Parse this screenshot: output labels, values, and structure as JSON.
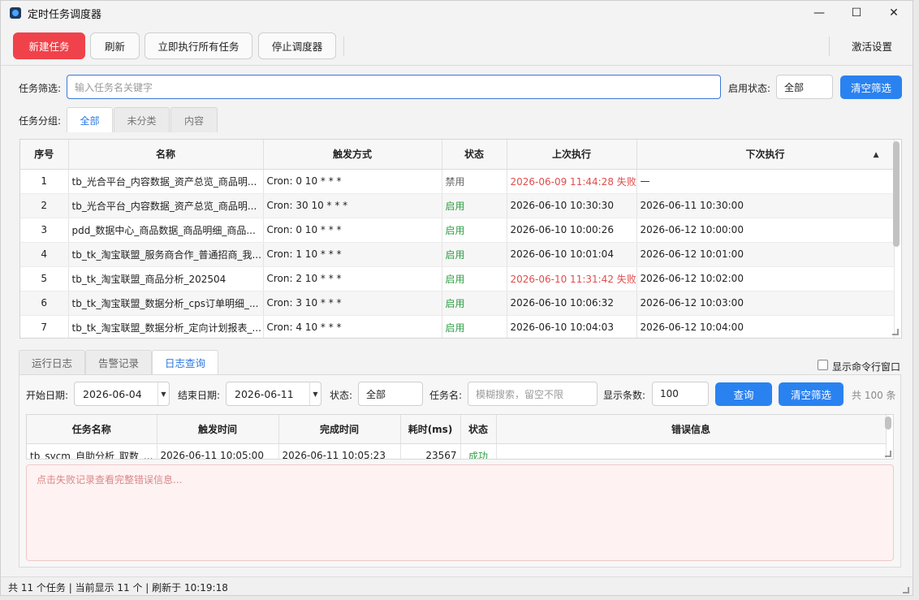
{
  "window": {
    "title": "定时任务调度器"
  },
  "win_controls": {
    "minimize": "—",
    "maximize": "☐",
    "close": "✕"
  },
  "toolbar": {
    "new_task": "新建任务",
    "refresh": "刷新",
    "run_all": "立即执行所有任务",
    "stop_scheduler": "停止调度器",
    "activate": "激活设置"
  },
  "filter": {
    "label": "任务筛选:",
    "placeholder": "输入任务名关键字",
    "status_label": "启用状态:",
    "status_value": "全部",
    "clear_button": "清空筛选"
  },
  "groups": {
    "label": "任务分组:",
    "tabs": [
      "全部",
      "未分类",
      "内容"
    ],
    "active": "全部"
  },
  "task_table": {
    "columns": [
      "序号",
      "名称",
      "触发方式",
      "状态",
      "上次执行",
      "下次执行"
    ],
    "sort_indicator": "▲",
    "rows": [
      {
        "no": "1",
        "name": "tb_光合平台_内容数据_资产总览_商品明...",
        "trigger": "Cron: 0 10 * * *",
        "status": "禁用",
        "last": "2026-06-09 11:44:28 失败",
        "next": "—"
      },
      {
        "no": "2",
        "name": "tb_光合平台_内容数据_资产总览_商品明...",
        "trigger": "Cron: 30 10 * * *",
        "status": "启用",
        "last": "2026-06-10 10:30:30",
        "next": "2026-06-11 10:30:00"
      },
      {
        "no": "3",
        "name": "pdd_数据中心_商品数据_商品明细_商品...",
        "trigger": "Cron: 0 10 * * *",
        "status": "启用",
        "last": "2026-06-10 10:00:26",
        "next": "2026-06-12 10:00:00"
      },
      {
        "no": "4",
        "name": "tb_tk_淘宝联盟_服务商合作_普通招商_我...",
        "trigger": "Cron: 1 10 * * *",
        "status": "启用",
        "last": "2026-06-10 10:01:04",
        "next": "2026-06-12 10:01:00"
      },
      {
        "no": "5",
        "name": "tb_tk_淘宝联盟_商品分析_202504",
        "trigger": "Cron: 2 10 * * *",
        "status": "启用",
        "last": "2026-06-10 11:31:42 失败",
        "next": "2026-06-12 10:02:00"
      },
      {
        "no": "6",
        "name": "tb_tk_淘宝联盟_数据分析_cps订单明细_...",
        "trigger": "Cron: 3 10 * * *",
        "status": "启用",
        "last": "2026-06-10 10:06:32",
        "next": "2026-06-12 10:03:00"
      },
      {
        "no": "7",
        "name": "tb_tk_淘宝联盟_数据分析_定向计划报表_...",
        "trigger": "Cron: 4 10 * * *",
        "status": "启用",
        "last": "2026-06-10 10:04:03",
        "next": "2026-06-12 10:04:00"
      }
    ]
  },
  "bottom_tabs": [
    "运行日志",
    "告警记录",
    "日志查询"
  ],
  "bottom_active": "日志查询",
  "show_cmd": {
    "label": "显示命令行窗口",
    "checked": false
  },
  "log_query": {
    "start_label": "开始日期:",
    "start_value": "2026-06-04",
    "end_label": "结束日期:",
    "end_value": "2026-06-11",
    "status_label": "状态:",
    "status_value": "全部",
    "task_label": "任务名:",
    "task_placeholder": "模糊搜索，留空不限",
    "count_label": "显示条数:",
    "count_value": "100",
    "query_button": "查询",
    "clear_button": "清空筛选",
    "total": "共 100 条"
  },
  "log_table": {
    "columns": [
      "任务名称",
      "触发时间",
      "完成时间",
      "耗时(ms)",
      "状态",
      "错误信息"
    ],
    "rows": [
      {
        "name": "tb_sycm_自助分析_取数_...",
        "trigger": "2026-06-11 10:05:00",
        "done": "2026-06-11 10:05:23",
        "ms": "23567",
        "status": "成功",
        "error": ""
      }
    ]
  },
  "error_hint": "点击失败记录查看完整错误信息...",
  "statusbar": {
    "text": "共 11 个任务 | 当前显示 11 个 | 刷新于 10:19:18"
  },
  "colors": {
    "accent": "#2a82f0",
    "danger": "#f0424a",
    "success": "#2e9e44"
  }
}
